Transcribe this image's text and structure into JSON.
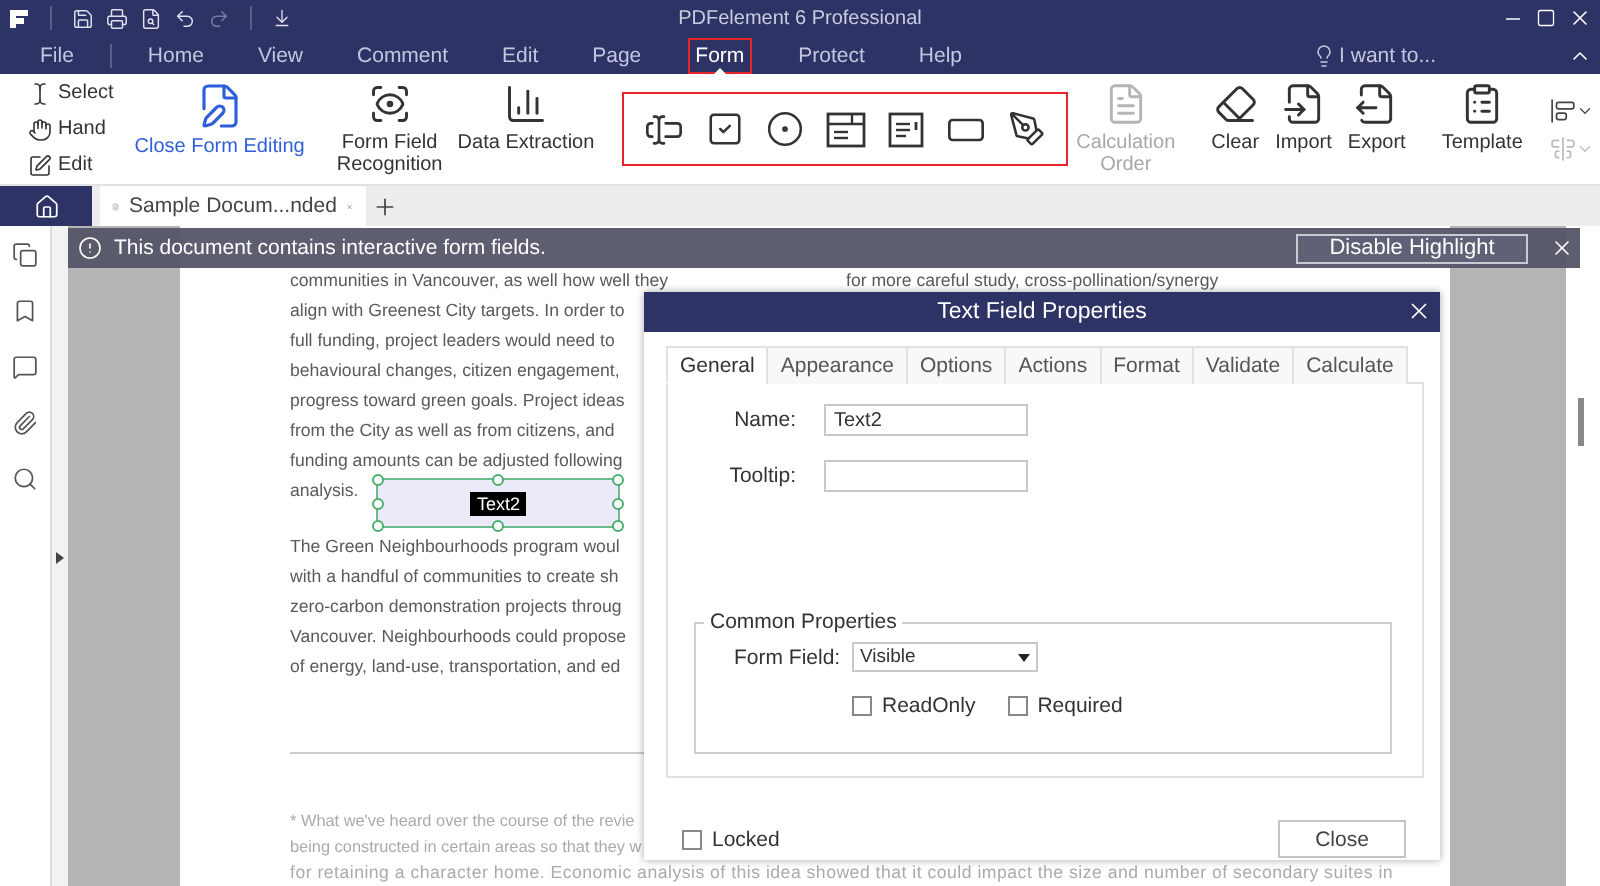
{
  "app": {
    "title": "PDFelement 6 Professional"
  },
  "menu": [
    {
      "label": "File",
      "selected": false
    },
    {
      "label": "Home",
      "selected": false
    },
    {
      "label": "View",
      "selected": false
    },
    {
      "label": "Comment",
      "selected": false
    },
    {
      "label": "Edit",
      "selected": false
    },
    {
      "label": "Page",
      "selected": false
    },
    {
      "label": "Form",
      "selected": true
    },
    {
      "label": "Protect",
      "selected": false
    },
    {
      "label": "Help",
      "selected": false
    }
  ],
  "assistant": {
    "label": "I want to..."
  },
  "ribbon": {
    "mode_tools": [
      "Select",
      "Hand",
      "Edit"
    ],
    "close_editing": "Close Form Editing",
    "recognition_tools": [
      "Form Field Recognition",
      "Data Extraction"
    ],
    "calculation_order": {
      "label": "Calculation Order",
      "disabled": true
    },
    "data_tools": [
      "Clear",
      "Import",
      "Export"
    ],
    "template": "Template"
  },
  "document_tabs": [
    {
      "label": "Sample Docum...nded",
      "selected": true
    }
  ],
  "banner": {
    "message": "This document contains interactive form fields.",
    "button": "Disable Highlight"
  },
  "document": {
    "paragraph_1": [
      "communities in Vancouver, as well how well they",
      "align with Greenest City targets. In order to",
      "full funding, project leaders would need to",
      "behavioural changes, citizen engagement,",
      "progress toward green goals. Project ideas",
      "from the City as well as from citizens, and",
      "funding amounts can be adjusted following"
    ],
    "last_line": "analysis.",
    "form_field": {
      "value": "Text2"
    },
    "paragraph_2": [
      "The Green Neighbourhoods program woul",
      "with a handful of communities to create sh",
      "zero-carbon demonstration projects throug",
      "Vancouver. Neighbourhoods could propose",
      "of energy, land-use, transportation, and ed"
    ],
    "right_column": [
      "for more careful study, cross-pollination/synergy"
    ],
    "footnote": [
      "* What we've heard over the course of the revie",
      "being constructed in certain areas so that they w",
      "for retaining a character home. Economic analysis of this idea showed that it could impact the size and number of secondary suites in"
    ]
  },
  "dialog": {
    "title": "Text Field Properties",
    "tabs": [
      {
        "label": "General",
        "selected": true
      },
      {
        "label": "Appearance",
        "selected": false
      },
      {
        "label": "Options",
        "selected": false
      },
      {
        "label": "Actions",
        "selected": false
      },
      {
        "label": "Format",
        "selected": false
      },
      {
        "label": "Validate",
        "selected": false
      },
      {
        "label": "Calculate",
        "selected": false
      }
    ],
    "fields": [
      {
        "label": "Name:",
        "value": "Text2"
      },
      {
        "label": "Tooltip:"
      }
    ],
    "group": {
      "legend": "Common Properties",
      "form_field": {
        "label": "Form Field:",
        "value": "Visible"
      },
      "checks": [
        {
          "label": "ReadOnly",
          "checked": false
        },
        {
          "label": "Required",
          "checked": false
        }
      ]
    },
    "locked": {
      "label": "Locked",
      "checked": false
    },
    "close": "Close"
  }
}
